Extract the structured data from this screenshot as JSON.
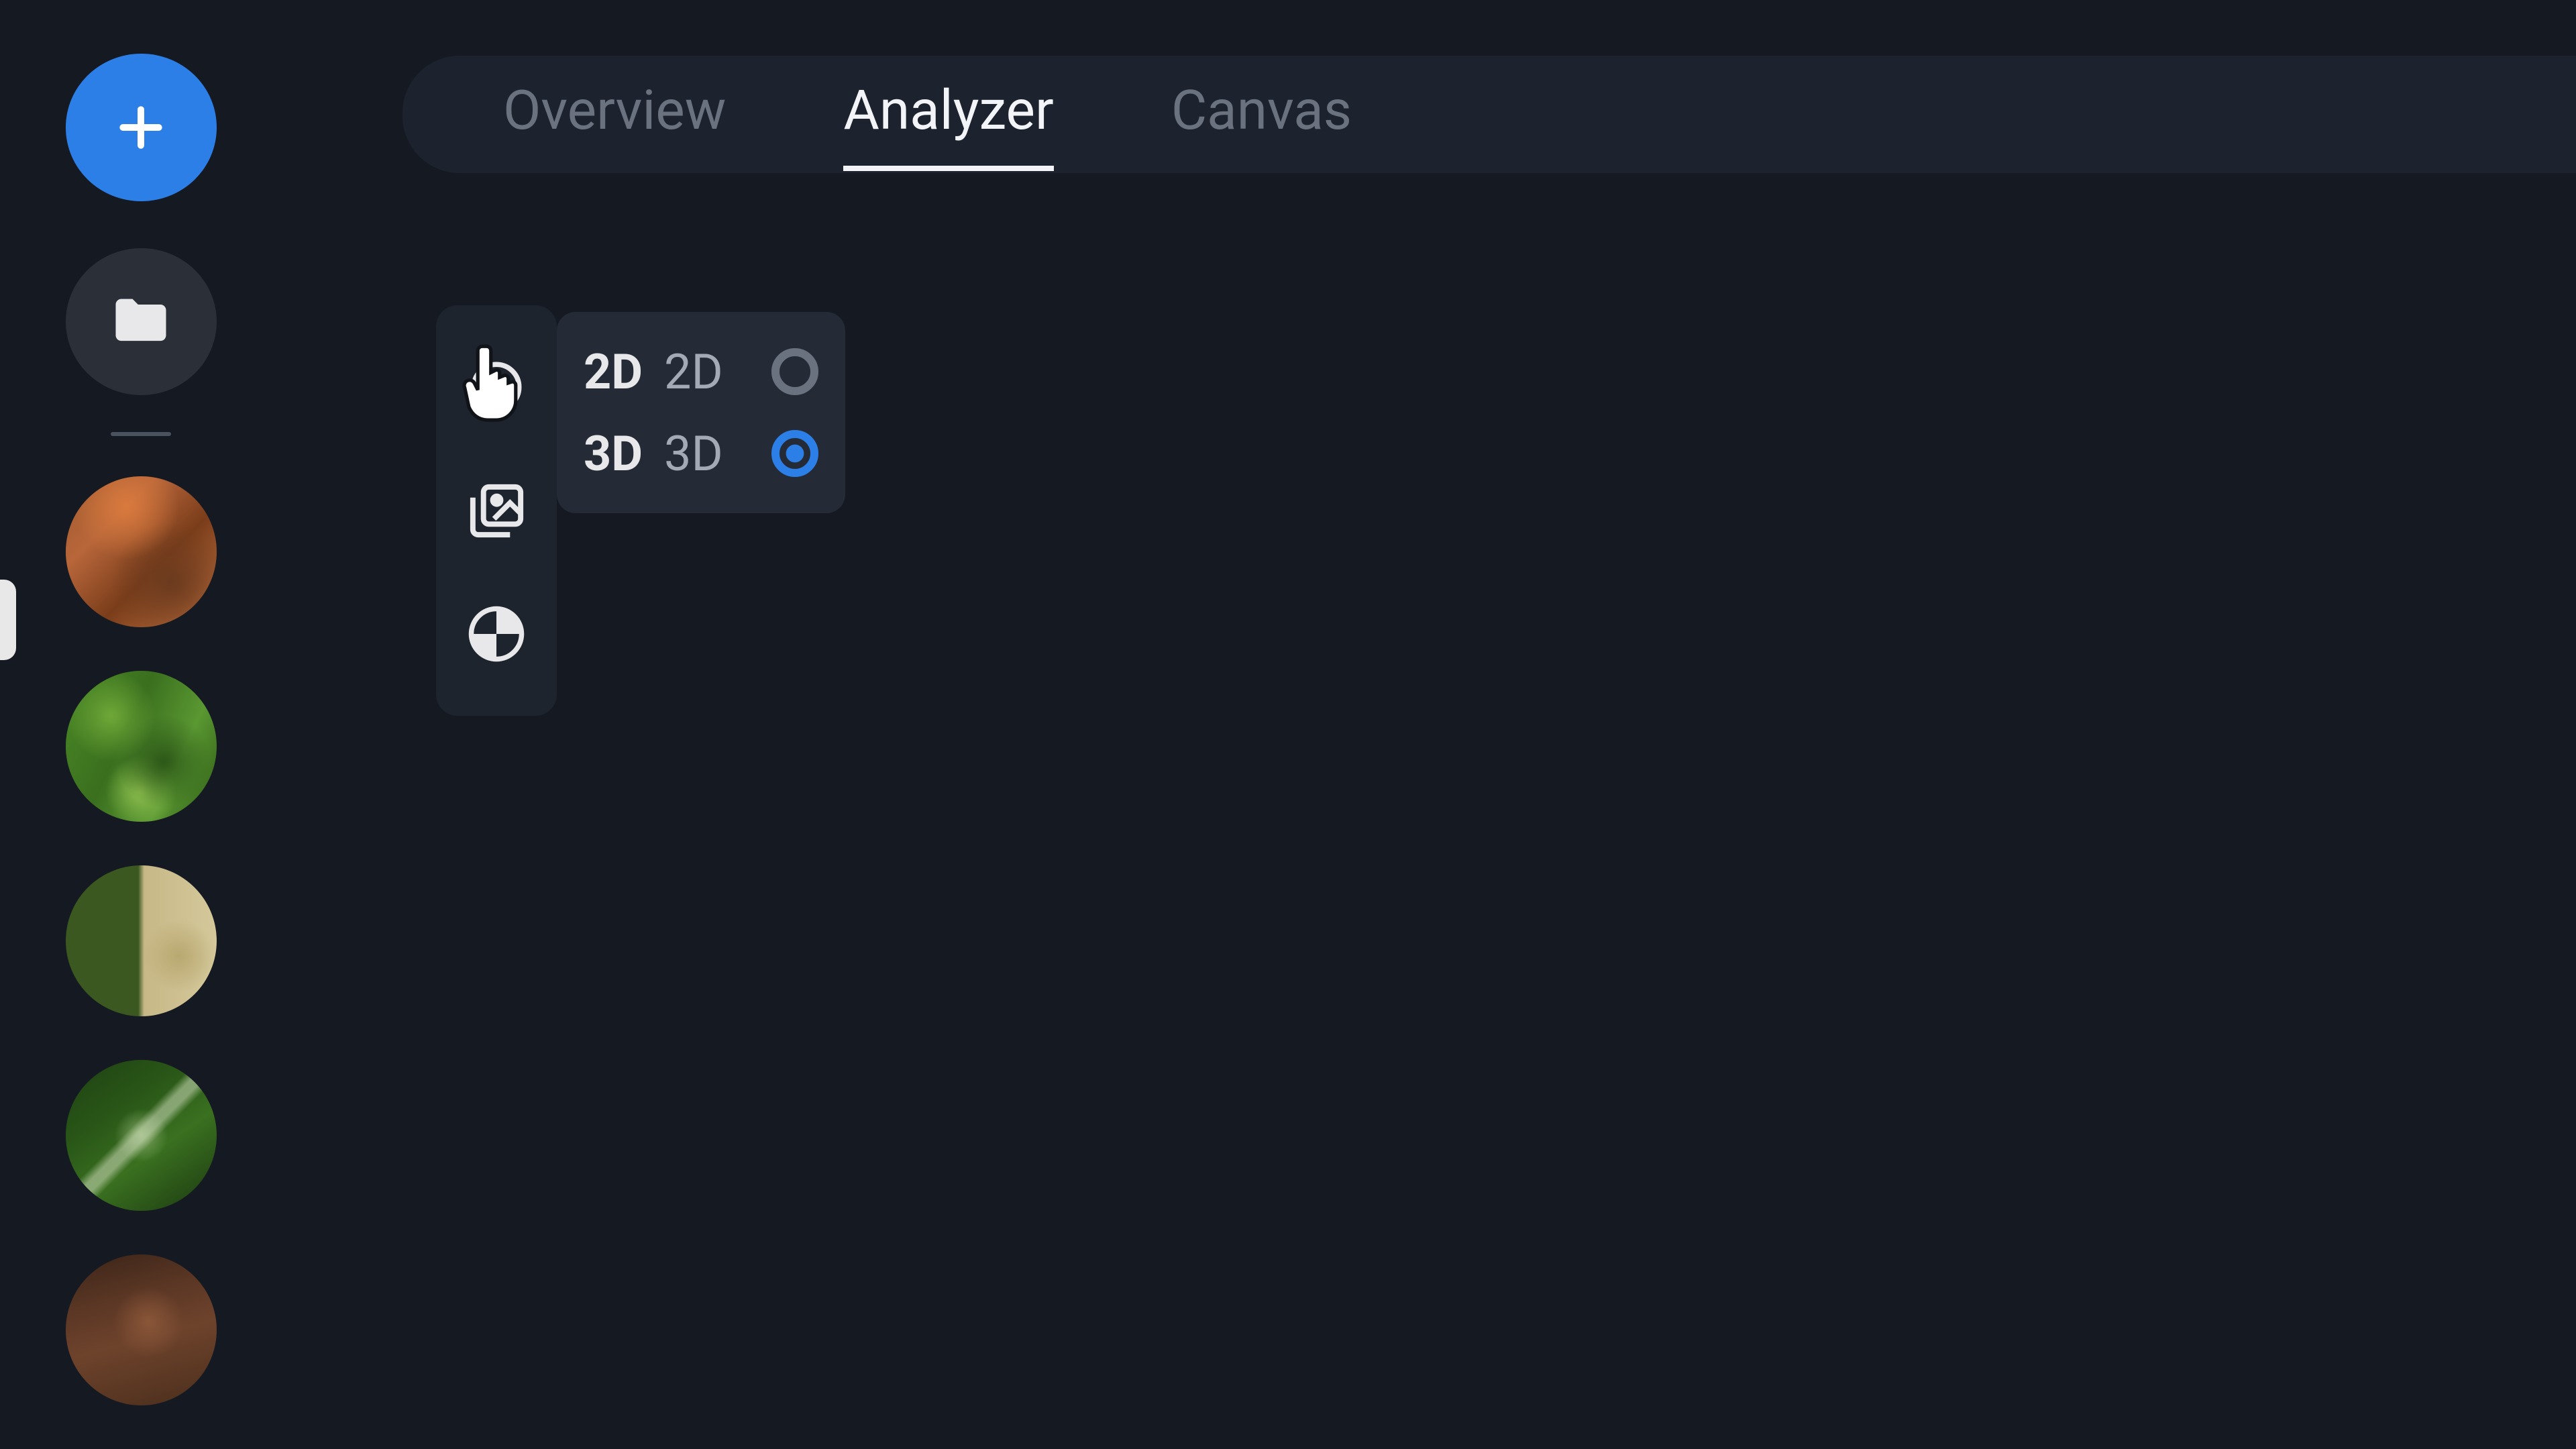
{
  "sidebar": {
    "add_icon": "plus-icon",
    "folder_icon": "folder-icon"
  },
  "tabs": [
    {
      "label": "Overview",
      "active": false
    },
    {
      "label": "Analyzer",
      "active": true
    },
    {
      "label": "Canvas",
      "active": false
    }
  ],
  "tools": {
    "cursor_icon": "pointer-icon",
    "layers_icon": "image-stack-icon",
    "marker_icon": "crosshair-icon"
  },
  "view_modes": [
    {
      "key": "2D",
      "label": "2D",
      "selected": false
    },
    {
      "key": "3D",
      "label": "3D",
      "selected": true
    }
  ],
  "colors": {
    "accent": "#2d7fe8",
    "background": "#151a22",
    "panel": "#1e242e",
    "text_primary": "#f2f4f7",
    "text_muted": "#6a7280"
  }
}
